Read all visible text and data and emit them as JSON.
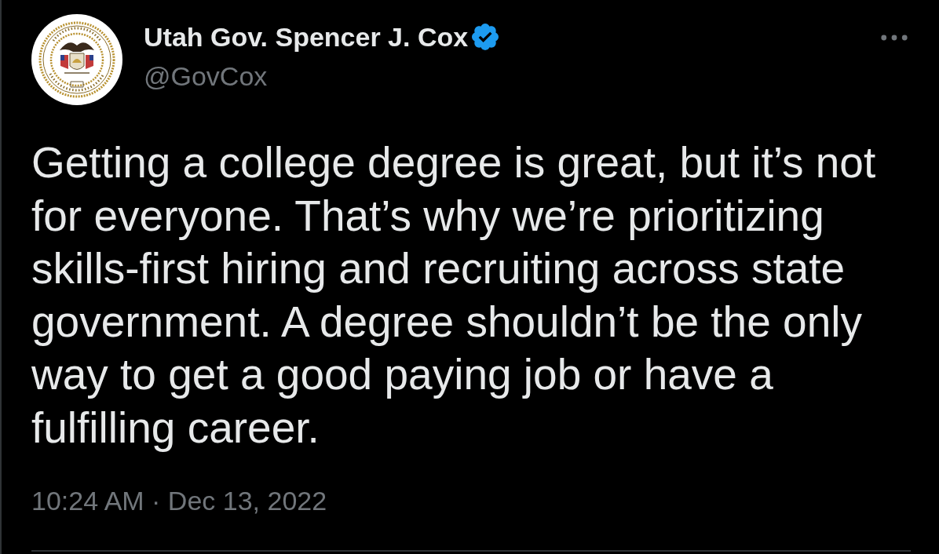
{
  "tweet": {
    "author": {
      "name": "Utah Gov. Spencer J. Cox",
      "verified": true,
      "handle": "@GovCox"
    },
    "text": "Getting a college degree is great, but it’s not for everyone. That’s why we’re prioritizing skills-first hiring and recruiting across state government. A degree shouldn’t be the only way to get a good paying job or have a fulfilling career.",
    "timestamp": "10:24 AM · Dec 13, 2022"
  }
}
